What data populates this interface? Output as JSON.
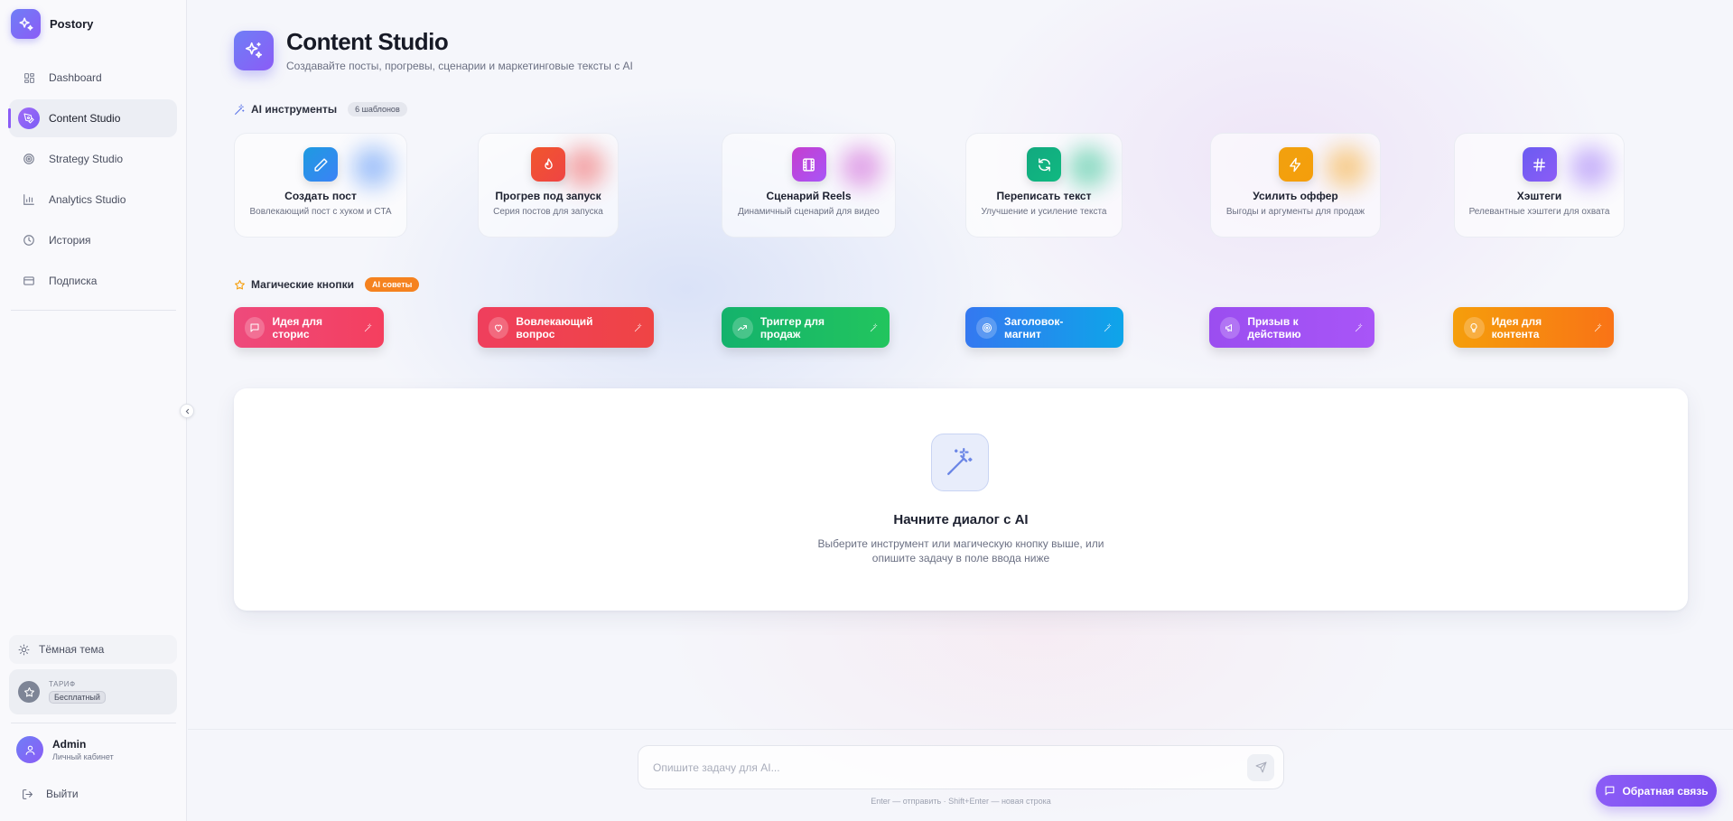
{
  "app": {
    "name": "Postory"
  },
  "sidebar": {
    "items": [
      {
        "label": "Dashboard",
        "icon": "dashboard-icon",
        "active": false
      },
      {
        "label": "Content Studio",
        "icon": "pen-nib-icon",
        "active": true
      },
      {
        "label": "Strategy Studio",
        "icon": "target-icon",
        "active": false
      },
      {
        "label": "Analytics Studio",
        "icon": "bar-chart-icon",
        "active": false
      },
      {
        "label": "История",
        "icon": "clock-icon",
        "active": false
      },
      {
        "label": "Подписка",
        "icon": "credit-card-icon",
        "active": false
      }
    ],
    "theme_toggle": "Тёмная тема",
    "plan": {
      "label": "ТАРИФ",
      "value": "Бесплатный"
    },
    "user": {
      "name": "Admin",
      "subtitle": "Личный кабинет"
    },
    "logout": "Выйти"
  },
  "header": {
    "title": "Content Studio",
    "subtitle": "Создавайте посты, прогревы, сценарии и маркетинговые тексты с AI"
  },
  "tools_section": {
    "title": "AI инструменты",
    "badge": "6 шаблонов",
    "tools": [
      {
        "title": "Создать пост",
        "desc": "Вовлекающий пост с хуком и CTA",
        "icon": "pencil-icon",
        "color": "#1e9be0",
        "color2": "#3b82f6"
      },
      {
        "title": "Прогрев под запуск",
        "desc": "Серия постов для запуска",
        "icon": "flame-icon",
        "color": "#f0562d",
        "color2": "#ef4444"
      },
      {
        "title": "Сценарий Reels",
        "desc": "Динамичный сценарий для видео",
        "icon": "film-icon",
        "color": "#c53ecf",
        "color2": "#a855f7"
      },
      {
        "title": "Переписать текст",
        "desc": "Улучшение и усиление текста",
        "icon": "refresh-icon",
        "color": "#12a97f",
        "color2": "#10b981"
      },
      {
        "title": "Усилить оффер",
        "desc": "Выгоды и аргументы для продаж",
        "icon": "lightning-icon",
        "color": "#f1a10f",
        "color2": "#f59e0b"
      },
      {
        "title": "Хэштеги",
        "desc": "Релевантные хэштеги для охвата",
        "icon": "hash-icon",
        "color": "#6b5cf1",
        "color2": "#8b5cf6"
      }
    ]
  },
  "magic_section": {
    "title": "Магические кнопки",
    "badge": "AI советы",
    "buttons": [
      {
        "label": "Идея для сторис",
        "icon": "message-square-icon",
        "gradient": [
          "#ee4a7c",
          "#f43f5e"
        ]
      },
      {
        "label": "Вовлекающий вопрос",
        "icon": "heart-icon",
        "gradient": [
          "#ef3f5d",
          "#ef4444"
        ]
      },
      {
        "label": "Триггер для продаж",
        "icon": "trending-up-icon",
        "gradient": [
          "#14b26c",
          "#22c55e"
        ]
      },
      {
        "label": "Заголовок-магнит",
        "icon": "target-icon",
        "gradient": [
          "#3478f0",
          "#0ea5e9"
        ]
      },
      {
        "label": "Призыв к действию",
        "icon": "megaphone-icon",
        "gradient": [
          "#9b4ef0",
          "#a855f7"
        ]
      },
      {
        "label": "Идея для контента",
        "icon": "lightbulb-icon",
        "gradient": [
          "#f59e0b",
          "#f97316"
        ]
      }
    ]
  },
  "chat": {
    "icon": "magic-wand-icon",
    "title": "Начните диалог с AI",
    "desc_line1": "Выберите инструмент или магическую кнопку выше, или",
    "desc_line2": "опишите задачу в поле ввода ниже"
  },
  "composer": {
    "placeholder": "Опишите задачу для AI...",
    "hint": "Enter — отправить · Shift+Enter — новая строка"
  },
  "feedback": {
    "label": "Обратная связь"
  }
}
